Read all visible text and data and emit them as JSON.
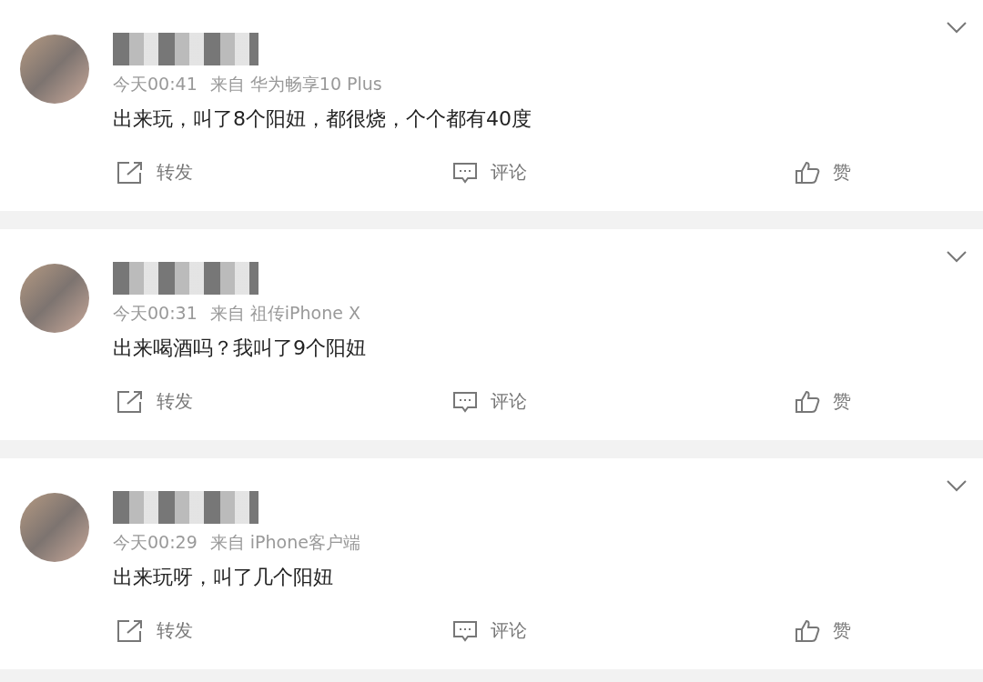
{
  "posts": [
    {
      "time": "今天00:41",
      "source": "来自 华为畅享10 Plus",
      "text": "出来玩，叫了8个阳妞，都很烧，个个都有40度",
      "actions": [
        {
          "kind": "repost",
          "label": "转发"
        },
        {
          "kind": "comment",
          "label": "评论"
        },
        {
          "kind": "like",
          "label": "赞"
        }
      ]
    },
    {
      "time": "今天00:31",
      "source": "来自 祖传iPhone X",
      "text": "出来喝酒吗？我叫了9个阳妞",
      "actions": [
        {
          "kind": "repost",
          "label": "转发"
        },
        {
          "kind": "comment",
          "label": "评论"
        },
        {
          "kind": "like",
          "label": "赞"
        }
      ]
    },
    {
      "time": "今天00:29",
      "source": "来自 iPhone客户端",
      "text": "出来玩呀，叫了几个阳妞",
      "actions": [
        {
          "kind": "repost",
          "label": "转发"
        },
        {
          "kind": "comment",
          "label": "评论"
        },
        {
          "kind": "like",
          "label": "赞"
        }
      ]
    }
  ]
}
